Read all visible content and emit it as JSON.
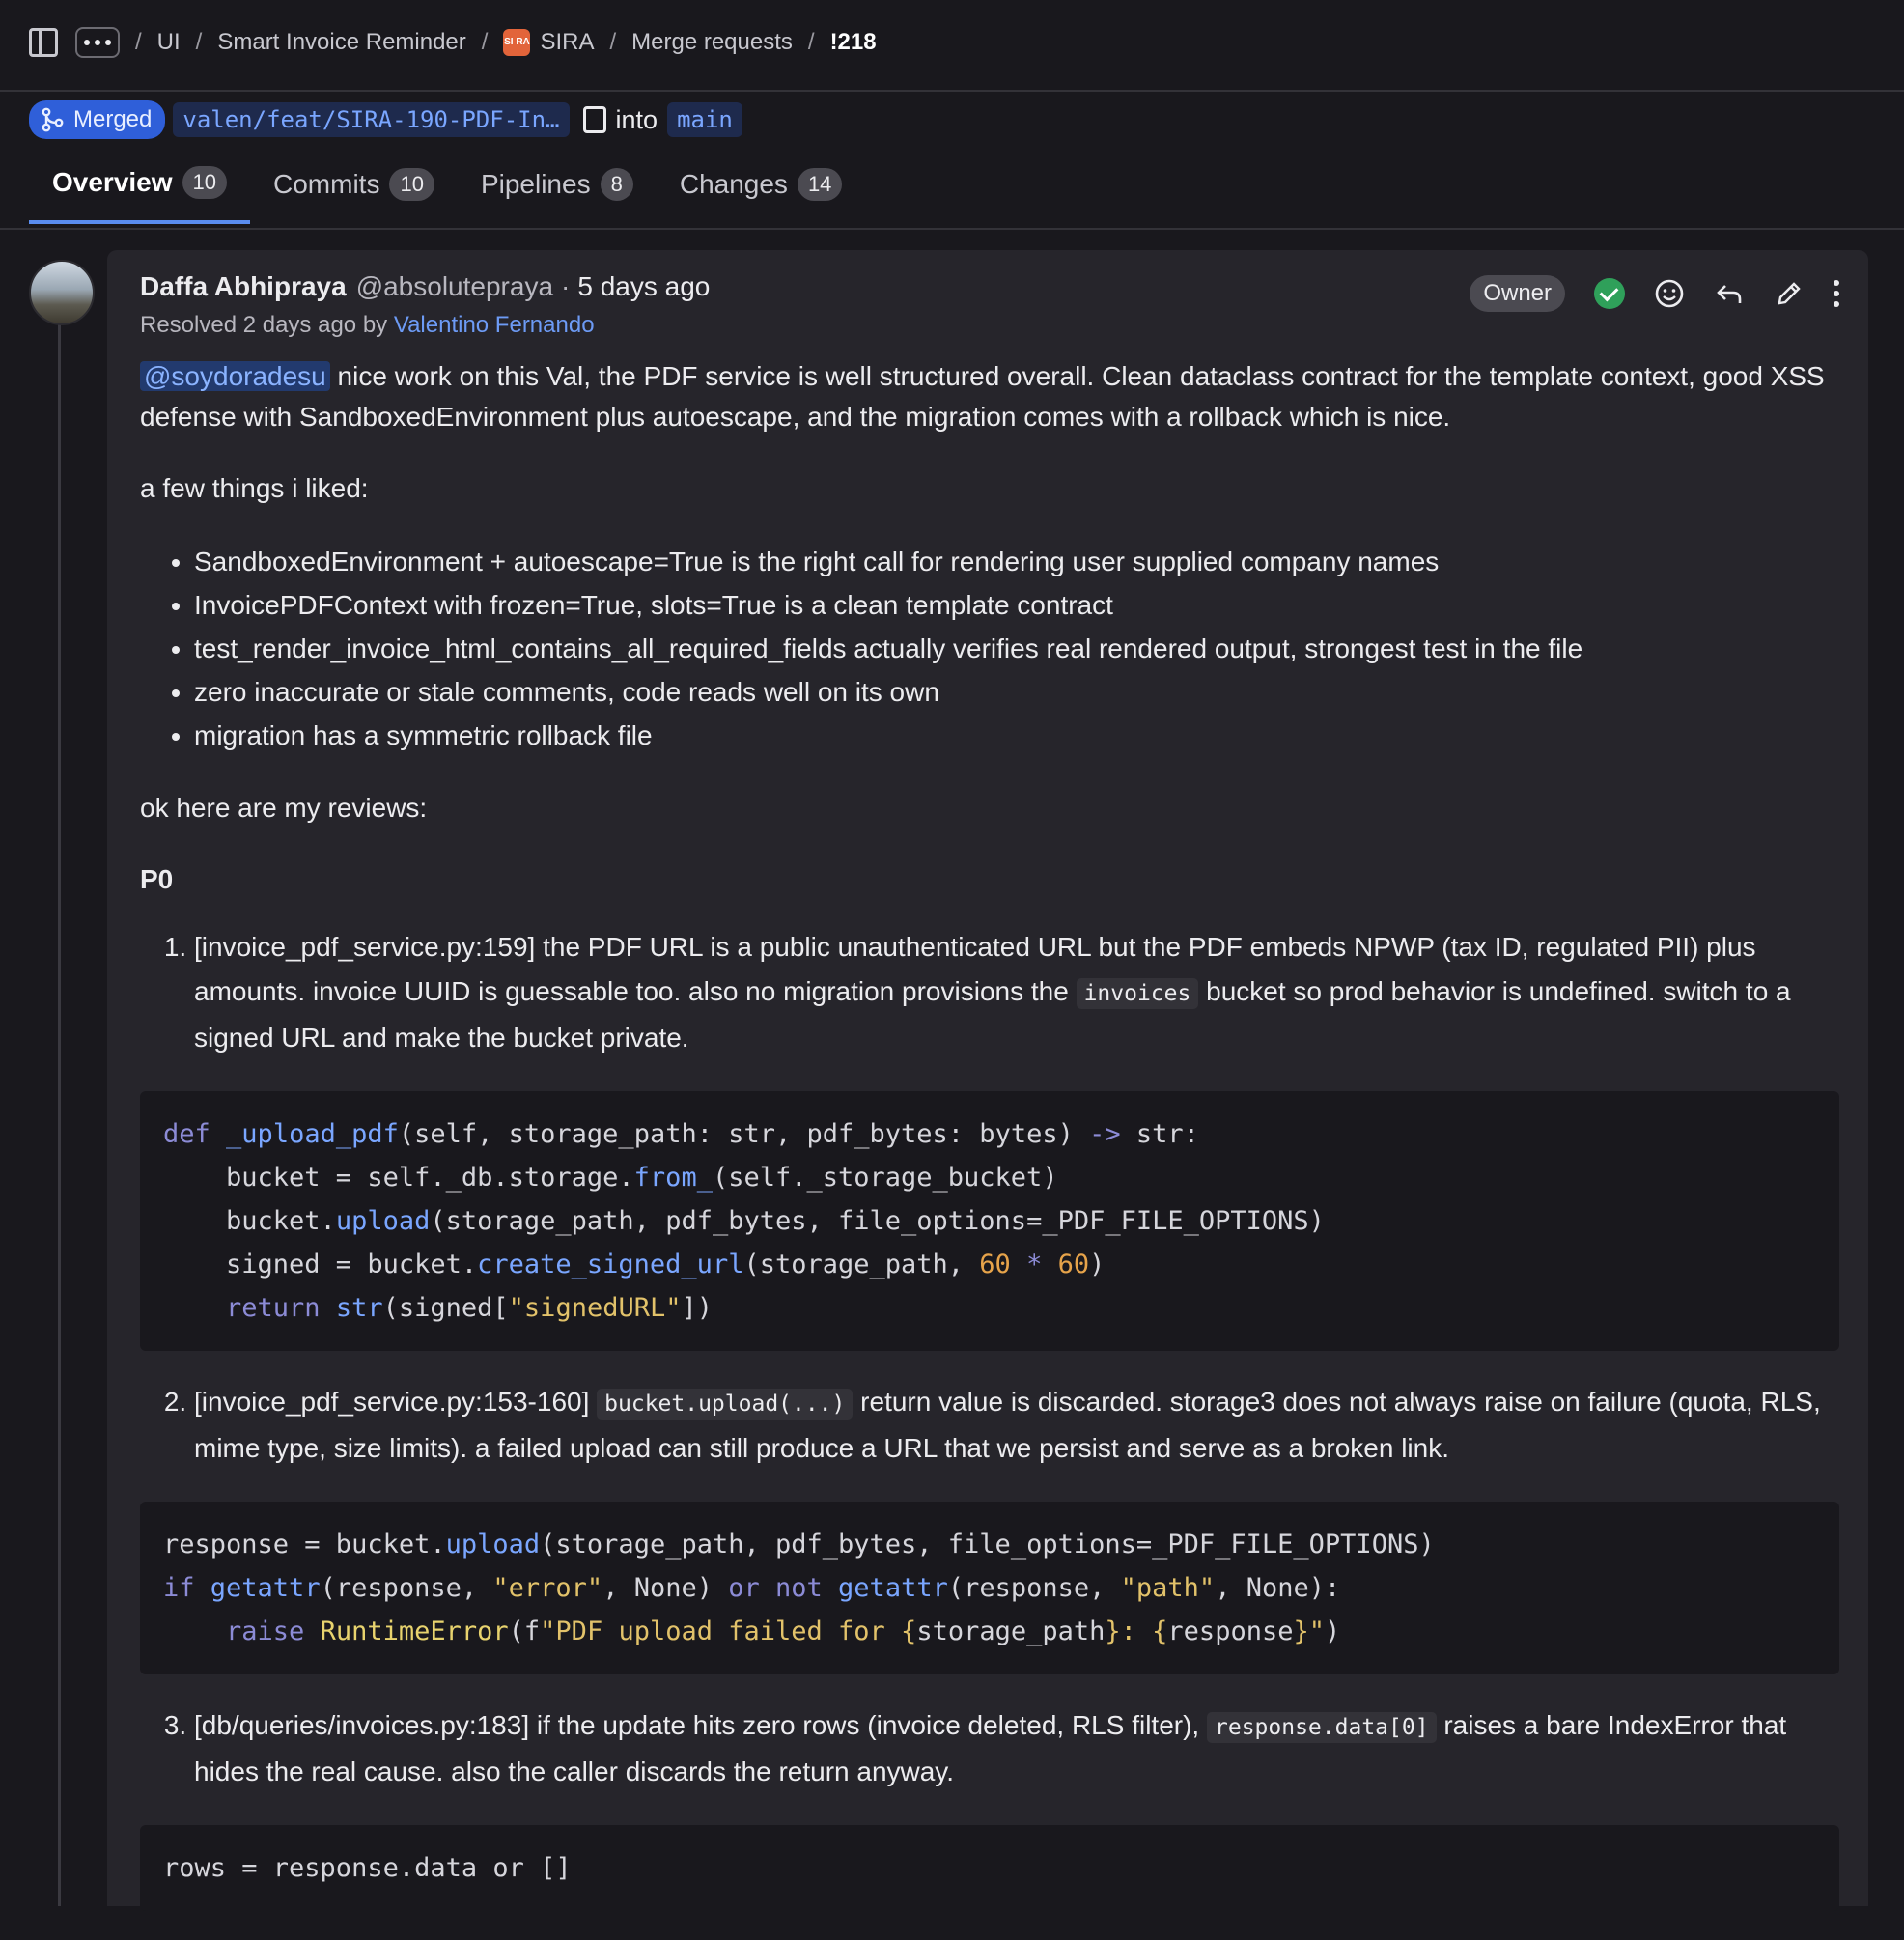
{
  "breadcrumb": {
    "items": [
      "UI",
      "Smart Invoice Reminder",
      "SIRA",
      "Merge requests",
      "!218"
    ],
    "project_icon_text": "SI RA",
    "separator": "/"
  },
  "status": {
    "badge": "Merged",
    "source_branch": "valen/feat/SIRA-190-PDF-In…",
    "into": "into",
    "target_branch": "main"
  },
  "tabs": [
    {
      "label": "Overview",
      "count": "10"
    },
    {
      "label": "Commits",
      "count": "10"
    },
    {
      "label": "Pipelines",
      "count": "8"
    },
    {
      "label": "Changes",
      "count": "14"
    }
  ],
  "comment": {
    "author": "Daffa Abhipraya",
    "handle": "@absolutepraya",
    "dot": "·",
    "time": "5 days ago",
    "resolved_prefix": "Resolved 2 days ago by",
    "resolved_by": "Valentino Fernando",
    "role": "Owner",
    "mention": "@soydoradesu",
    "intro": " nice work on this Val, the PDF service is well structured overall. Clean dataclass contract for the template context, good XSS defense with SandboxedEnvironment plus autoescape, and the migration comes with a rollback which is nice.",
    "liked_heading": "a few things i liked:",
    "liked": [
      "SandboxedEnvironment + autoescape=True is the right call for rendering user supplied company names",
      "InvoicePDFContext with frozen=True, slots=True is a clean template contract",
      "test_render_invoice_html_contains_all_required_fields actually verifies real rendered output, strongest test in the file",
      "zero inaccurate or stale comments, code reads well on its own",
      "migration has a symmetric rollback file"
    ],
    "reviews_heading": "ok here are my reviews:",
    "priority": "P0",
    "item1": {
      "a": "[invoice_pdf_service.py:159] the PDF URL is a public unauthenticated URL but the PDF embeds NPWP (tax ID, regulated PII) plus amounts. invoice UUID is guessable too. also no migration provisions the ",
      "code": "invoices",
      "b": " bucket so prod behavior is undefined. switch to a signed URL and make the bucket private."
    },
    "item2": {
      "a": "[invoice_pdf_service.py:153-160] ",
      "code": "bucket.upload(...)",
      "b": " return value is discarded. storage3 does not always raise on failure (quota, RLS, mime type, size limits). a failed upload can still produce a URL that we persist and serve as a broken link."
    },
    "item3": {
      "a": "[db/queries/invoices.py:183] if the update hits zero rows (invoice deleted, RLS filter), ",
      "code": "response.data[0]",
      "b": " raises a bare IndexError that hides the real cause. also the caller discards the return anyway."
    },
    "code_last": "rows = response.data or []"
  }
}
